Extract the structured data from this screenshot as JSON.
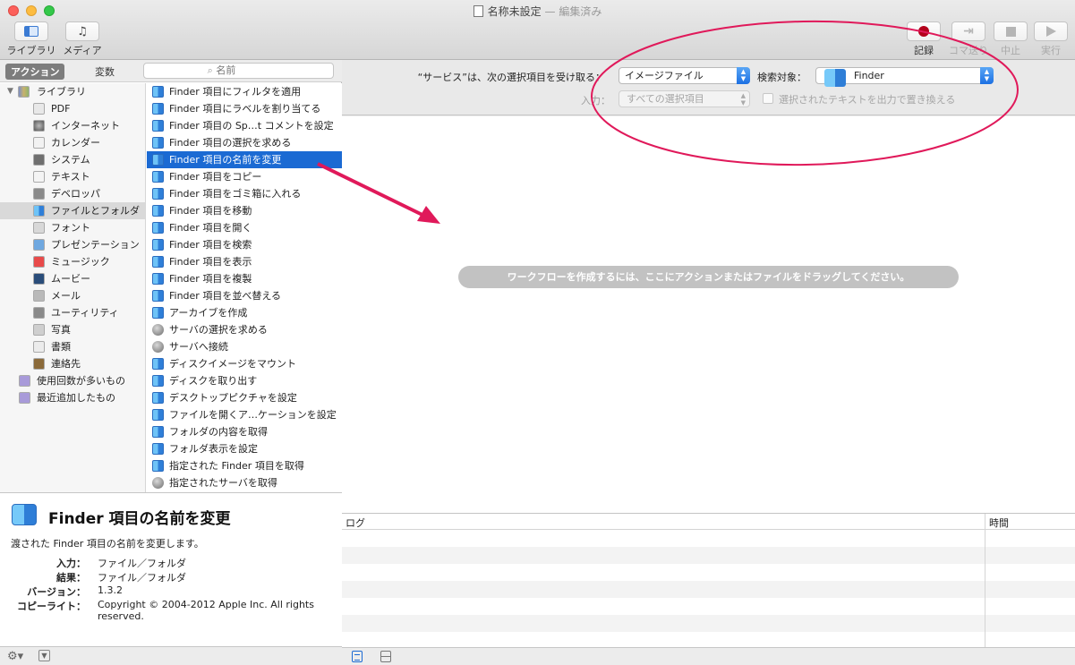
{
  "window": {
    "title": "名称未設定",
    "edited": "— 編集済み"
  },
  "toolbar": {
    "library_label": "ライブラリ",
    "media_label": "メディア",
    "record_label": "記録",
    "step_label": "コマ送り",
    "stop_label": "中止",
    "run_label": "実行"
  },
  "left": {
    "tab_actions": "アクション",
    "tab_variables": "変数",
    "search_placeholder": "名前",
    "categories": [
      {
        "label": "ライブラリ",
        "icon": "library-icon",
        "level": 0
      },
      {
        "label": "PDF",
        "icon": "pdf-icon",
        "level": 1
      },
      {
        "label": "インターネット",
        "icon": "internet-icon",
        "level": 1
      },
      {
        "label": "カレンダー",
        "icon": "calendar-icon",
        "level": 1
      },
      {
        "label": "システム",
        "icon": "system-icon",
        "level": 1
      },
      {
        "label": "テキスト",
        "icon": "text-icon",
        "level": 1
      },
      {
        "label": "デベロッパ",
        "icon": "developer-icon",
        "level": 1
      },
      {
        "label": "ファイルとフォルダ",
        "icon": "files-folders-icon",
        "level": 1,
        "selected": true
      },
      {
        "label": "フォント",
        "icon": "fonts-icon",
        "level": 1
      },
      {
        "label": "プレゼンテーション",
        "icon": "presentation-icon",
        "level": 1
      },
      {
        "label": "ミュージック",
        "icon": "music-icon",
        "level": 1
      },
      {
        "label": "ムービー",
        "icon": "movie-icon",
        "level": 1
      },
      {
        "label": "メール",
        "icon": "mail-icon",
        "level": 1
      },
      {
        "label": "ユーティリティ",
        "icon": "utilities-icon",
        "level": 1
      },
      {
        "label": "写真",
        "icon": "photos-icon",
        "level": 1
      },
      {
        "label": "書類",
        "icon": "documents-icon",
        "level": 1
      },
      {
        "label": "連絡先",
        "icon": "contacts-icon",
        "level": 1
      },
      {
        "label": "使用回数が多いもの",
        "icon": "smart-folder-icon",
        "level": 0
      },
      {
        "label": "最近追加したもの",
        "icon": "smart-folder-icon",
        "level": 0
      }
    ],
    "actions": [
      {
        "label": "Finder 項目にフィルタを適用",
        "icon": "finder-icon"
      },
      {
        "label": "Finder 項目にラベルを割り当てる",
        "icon": "finder-icon"
      },
      {
        "label": "Finder 項目の Sp…t コメントを設定",
        "icon": "finder-icon"
      },
      {
        "label": "Finder 項目の選択を求める",
        "icon": "finder-icon"
      },
      {
        "label": "Finder 項目の名前を変更",
        "icon": "finder-icon",
        "selected": true
      },
      {
        "label": "Finder 項目をコピー",
        "icon": "finder-icon"
      },
      {
        "label": "Finder 項目をゴミ箱に入れる",
        "icon": "finder-icon"
      },
      {
        "label": "Finder 項目を移動",
        "icon": "finder-icon"
      },
      {
        "label": "Finder 項目を開く",
        "icon": "finder-icon"
      },
      {
        "label": "Finder 項目を検索",
        "icon": "finder-icon"
      },
      {
        "label": "Finder 項目を表示",
        "icon": "finder-icon"
      },
      {
        "label": "Finder 項目を複製",
        "icon": "finder-icon"
      },
      {
        "label": "Finder 項目を並べ替える",
        "icon": "finder-icon"
      },
      {
        "label": "アーカイブを作成",
        "icon": "finder-icon"
      },
      {
        "label": "サーバの選択を求める",
        "icon": "globe-icon"
      },
      {
        "label": "サーバへ接続",
        "icon": "globe-icon"
      },
      {
        "label": "ディスクイメージをマウント",
        "icon": "finder-icon"
      },
      {
        "label": "ディスクを取り出す",
        "icon": "finder-icon"
      },
      {
        "label": "デスクトップピクチャを設定",
        "icon": "finder-icon"
      },
      {
        "label": "ファイルを開くア…ケーションを設定",
        "icon": "finder-icon"
      },
      {
        "label": "フォルダの内容を取得",
        "icon": "finder-icon"
      },
      {
        "label": "フォルダ表示を設定",
        "icon": "finder-icon"
      },
      {
        "label": "指定された Finder 項目を取得",
        "icon": "finder-icon"
      },
      {
        "label": "指定されたサーバを取得",
        "icon": "globe-icon"
      }
    ]
  },
  "description": {
    "title": "Finder 項目の名前を変更",
    "text": "渡された Finder 項目の名前を変更します。",
    "input_key": "入力：",
    "input_value": "ファイル／フォルダ",
    "result_key": "結果：",
    "result_value": "ファイル／フォルダ",
    "version_key": "バージョン：",
    "version_value": "1.3.2",
    "copyright_key": "コピーライト：",
    "copyright_value": "Copyright © 2004-2012 Apple Inc.  All rights reserved."
  },
  "workflow": {
    "service_label": "“サービス”は、次の選択項目を受け取る：",
    "service_input_value": "イメージファイル",
    "target_label": "検索対象：",
    "target_app": "Finder",
    "input_label": "入力：",
    "input_value": "すべての選択項目",
    "replace_label": "選択されたテキストを出力で置き換える",
    "hint": "ワークフローを作成するには、ここにアクションまたはファイルをドラッグしてください。"
  },
  "log": {
    "col_log": "ログ",
    "col_time": "時間"
  },
  "colors": {
    "selection": "#1b6ad3",
    "annotation": "#e0195a",
    "record": "#b3001b"
  }
}
